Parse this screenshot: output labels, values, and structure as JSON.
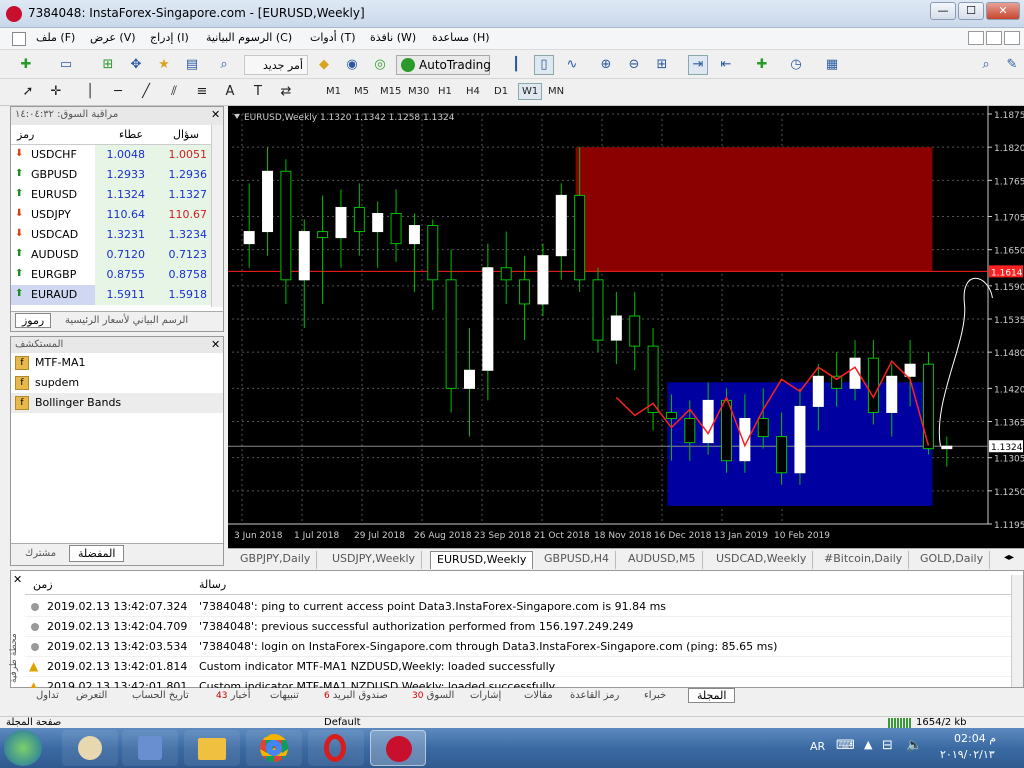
{
  "window": {
    "title": "7384048: InstaForex-Singapore.com - [EURUSD,Weekly]",
    "minimize": "—",
    "maximize": "☐",
    "close": "✕"
  },
  "menu": [
    "ملف (F)",
    "عرض (V)",
    "إدراج (I)",
    "الرسوم البيانية (C)",
    "أدوات (T)",
    "نافذة (W)",
    "مساعدة (H)"
  ],
  "toolbar": {
    "new_order": "أمر جديد",
    "autotrading": "AutoTrading"
  },
  "timeframes": [
    "M1",
    "M5",
    "M15",
    "M30",
    "H1",
    "H4",
    "D1",
    "W1",
    "MN"
  ],
  "market_watch": {
    "title": "مراقبة السوق: ١٤:٠٤:٣٢",
    "col_symbol": "رمز",
    "col_bid": "عطاء",
    "col_ask": "سؤال",
    "rows": [
      {
        "symbol": "USDCHF",
        "bid": "1.0048",
        "ask": "1.0051",
        "dir": "down"
      },
      {
        "symbol": "GBPUSD",
        "bid": "1.2933",
        "ask": "1.2936",
        "dir": "up"
      },
      {
        "symbol": "EURUSD",
        "bid": "1.1324",
        "ask": "1.1327",
        "dir": "up"
      },
      {
        "symbol": "USDJPY",
        "bid": "110.64",
        "ask": "110.67",
        "dir": "down"
      },
      {
        "symbol": "USDCAD",
        "bid": "1.3231",
        "ask": "1.3234",
        "dir": "down"
      },
      {
        "symbol": "AUDUSD",
        "bid": "0.7120",
        "ask": "0.7123",
        "dir": "up"
      },
      {
        "symbol": "EURGBP",
        "bid": "0.8755",
        "ask": "0.8758",
        "dir": "up"
      },
      {
        "symbol": "EURAUD",
        "bid": "1.5911",
        "ask": "1.5918",
        "dir": "up"
      }
    ],
    "tab_symbols": "رموز",
    "tab_chart": "الرسم البياني لأسعار الرئيسية"
  },
  "navigator": {
    "title": "المستكشف",
    "items": [
      "MTF-MA1",
      "supdem",
      "Bollinger Bands"
    ],
    "tab_favorites": "المفضلة",
    "tab_common": "مشترك"
  },
  "chart": {
    "header": "EURUSD,Weekly  1.1320 1.1342 1.1258 1.1324",
    "price_labels": [
      "1.1875",
      "1.1820",
      "1.1765",
      "1.1705",
      "1.1650",
      "1.1590",
      "1.1535",
      "1.1480",
      "1.1420",
      "1.1365",
      "1.1305",
      "1.1250",
      "1.1195"
    ],
    "current_price": "1.1324",
    "hline_price": "1.1614",
    "date_labels": [
      "3 Jun 2018",
      "1 Jul 2018",
      "29 Jul 2018",
      "26 Aug 2018",
      "23 Sep 2018",
      "21 Oct 2018",
      "18 Nov 2018",
      "16 Dec 2018",
      "13 Jan 2019",
      "10 Feb 2019"
    ],
    "bull_color": "#ffffff",
    "bear_color": "#000000",
    "wick_color": "#00c000",
    "supply_zone_color": "#8b0000",
    "demand_zone_color": "#0000a0",
    "ma_color": "#ff2020"
  },
  "chart_data": {
    "type": "candlestick",
    "symbol": "EURUSD",
    "timeframe": "Weekly",
    "ylim": [
      1.1195,
      1.1875
    ],
    "candles": [
      {
        "o": 1.166,
        "h": 1.176,
        "l": 1.162,
        "c": 1.168
      },
      {
        "o": 1.168,
        "h": 1.182,
        "l": 1.164,
        "c": 1.178
      },
      {
        "o": 1.178,
        "h": 1.18,
        "l": 1.156,
        "c": 1.16
      },
      {
        "o": 1.16,
        "h": 1.17,
        "l": 1.152,
        "c": 1.168
      },
      {
        "o": 1.168,
        "h": 1.174,
        "l": 1.156,
        "c": 1.167
      },
      {
        "o": 1.167,
        "h": 1.175,
        "l": 1.162,
        "c": 1.172
      },
      {
        "o": 1.172,
        "h": 1.176,
        "l": 1.164,
        "c": 1.168
      },
      {
        "o": 1.168,
        "h": 1.173,
        "l": 1.162,
        "c": 1.171
      },
      {
        "o": 1.171,
        "h": 1.175,
        "l": 1.163,
        "c": 1.166
      },
      {
        "o": 1.166,
        "h": 1.171,
        "l": 1.158,
        "c": 1.169
      },
      {
        "o": 1.169,
        "h": 1.17,
        "l": 1.155,
        "c": 1.16
      },
      {
        "o": 1.16,
        "h": 1.165,
        "l": 1.138,
        "c": 1.142
      },
      {
        "o": 1.142,
        "h": 1.152,
        "l": 1.134,
        "c": 1.145
      },
      {
        "o": 1.145,
        "h": 1.166,
        "l": 1.14,
        "c": 1.162
      },
      {
        "o": 1.162,
        "h": 1.168,
        "l": 1.156,
        "c": 1.16
      },
      {
        "o": 1.16,
        "h": 1.164,
        "l": 1.15,
        "c": 1.156
      },
      {
        "o": 1.156,
        "h": 1.166,
        "l": 1.154,
        "c": 1.164
      },
      {
        "o": 1.164,
        "h": 1.176,
        "l": 1.16,
        "c": 1.174
      },
      {
        "o": 1.174,
        "h": 1.182,
        "l": 1.158,
        "c": 1.16
      },
      {
        "o": 1.16,
        "h": 1.162,
        "l": 1.148,
        "c": 1.15
      },
      {
        "o": 1.15,
        "h": 1.158,
        "l": 1.146,
        "c": 1.154
      },
      {
        "o": 1.154,
        "h": 1.158,
        "l": 1.145,
        "c": 1.149
      },
      {
        "o": 1.149,
        "h": 1.152,
        "l": 1.135,
        "c": 1.138
      },
      {
        "o": 1.138,
        "h": 1.141,
        "l": 1.13,
        "c": 1.137
      },
      {
        "o": 1.137,
        "h": 1.14,
        "l": 1.13,
        "c": 1.133
      },
      {
        "o": 1.133,
        "h": 1.143,
        "l": 1.131,
        "c": 1.14
      },
      {
        "o": 1.14,
        "h": 1.142,
        "l": 1.128,
        "c": 1.13
      },
      {
        "o": 1.13,
        "h": 1.141,
        "l": 1.128,
        "c": 1.137
      },
      {
        "o": 1.137,
        "h": 1.142,
        "l": 1.132,
        "c": 1.134
      },
      {
        "o": 1.134,
        "h": 1.138,
        "l": 1.126,
        "c": 1.128
      },
      {
        "o": 1.128,
        "h": 1.142,
        "l": 1.126,
        "c": 1.139
      },
      {
        "o": 1.139,
        "h": 1.146,
        "l": 1.135,
        "c": 1.144
      },
      {
        "o": 1.144,
        "h": 1.148,
        "l": 1.139,
        "c": 1.142
      },
      {
        "o": 1.142,
        "h": 1.15,
        "l": 1.14,
        "c": 1.147
      },
      {
        "o": 1.147,
        "h": 1.15,
        "l": 1.136,
        "c": 1.138
      },
      {
        "o": 1.138,
        "h": 1.146,
        "l": 1.134,
        "c": 1.144
      },
      {
        "o": 1.144,
        "h": 1.15,
        "l": 1.139,
        "c": 1.146
      },
      {
        "o": 1.146,
        "h": 1.148,
        "l": 1.131,
        "c": 1.132
      },
      {
        "o": 1.132,
        "h": 1.134,
        "l": 1.129,
        "c": 1.1324
      }
    ],
    "ma": [
      1.1405,
      1.1375,
      1.1395,
      1.1355,
      1.1385,
      1.1345,
      1.1405,
      1.1325,
      1.1385,
      1.1435,
      1.1415,
      1.1455,
      1.1435,
      1.1455,
      1.1405,
      1.1465,
      1.1435,
      1.1325
    ]
  },
  "chart_tabs": [
    "GBPJPY,Daily",
    "USDJPY,Weekly",
    "EURUSD,Weekly",
    "GBPUSD,H4",
    "AUDUSD,M5",
    "USDCAD,Weekly",
    "#Bitcoin,Daily",
    "GOLD,Daily"
  ],
  "chart_tabs_active": 2,
  "terminal": {
    "col_time": "زمن",
    "col_message": "رسالة",
    "side_label": "محطة طرفية",
    "rows": [
      {
        "time": "2019.02.13 13:42:07.324",
        "msg": "'7384048': ping to current access point Data3.InstaForex-Singapore.com is 91.84 ms",
        "level": "info"
      },
      {
        "time": "2019.02.13 13:42:04.709",
        "msg": "'7384048': previous successful authorization performed from 156.197.249.249",
        "level": "info"
      },
      {
        "time": "2019.02.13 13:42:03.534",
        "msg": "'7384048': login on InstaForex-Singapore.com through Data3.InstaForex-Singapore.com (ping: 85.65 ms)",
        "level": "info"
      },
      {
        "time": "2019.02.13 13:42:01.814",
        "msg": "Custom indicator MTF-MA1 NZDUSD,Weekly: loaded successfully",
        "level": "warn"
      },
      {
        "time": "2019.02.13 13:42:01.801",
        "msg": "Custom indicator MTF-MA1 NZDUSD,Weekly: loaded successfully",
        "level": "warn"
      }
    ],
    "tabs": [
      {
        "label": "تداول",
        "n": ""
      },
      {
        "label": "التعرض",
        "n": ""
      },
      {
        "label": "تاريخ الحساب",
        "n": ""
      },
      {
        "label": "أخبار",
        "n": "43"
      },
      {
        "label": "تنبيهات",
        "n": ""
      },
      {
        "label": "صندوق البريد",
        "n": "6"
      },
      {
        "label": "السوق",
        "n": "30"
      },
      {
        "label": "إشارات",
        "n": ""
      },
      {
        "label": "مقالات",
        "n": ""
      },
      {
        "label": "رمز القاعدة",
        "n": ""
      },
      {
        "label": "خبراء",
        "n": ""
      },
      {
        "label": "المجلة",
        "n": ""
      }
    ]
  },
  "status": {
    "help": "صفحة المجلة",
    "profile": "Default",
    "traffic": "1654/2 kb"
  },
  "taskbar": {
    "lang": "AR",
    "time": "02:04 م",
    "date": "٢٠١٩/٠٢/١٣"
  }
}
